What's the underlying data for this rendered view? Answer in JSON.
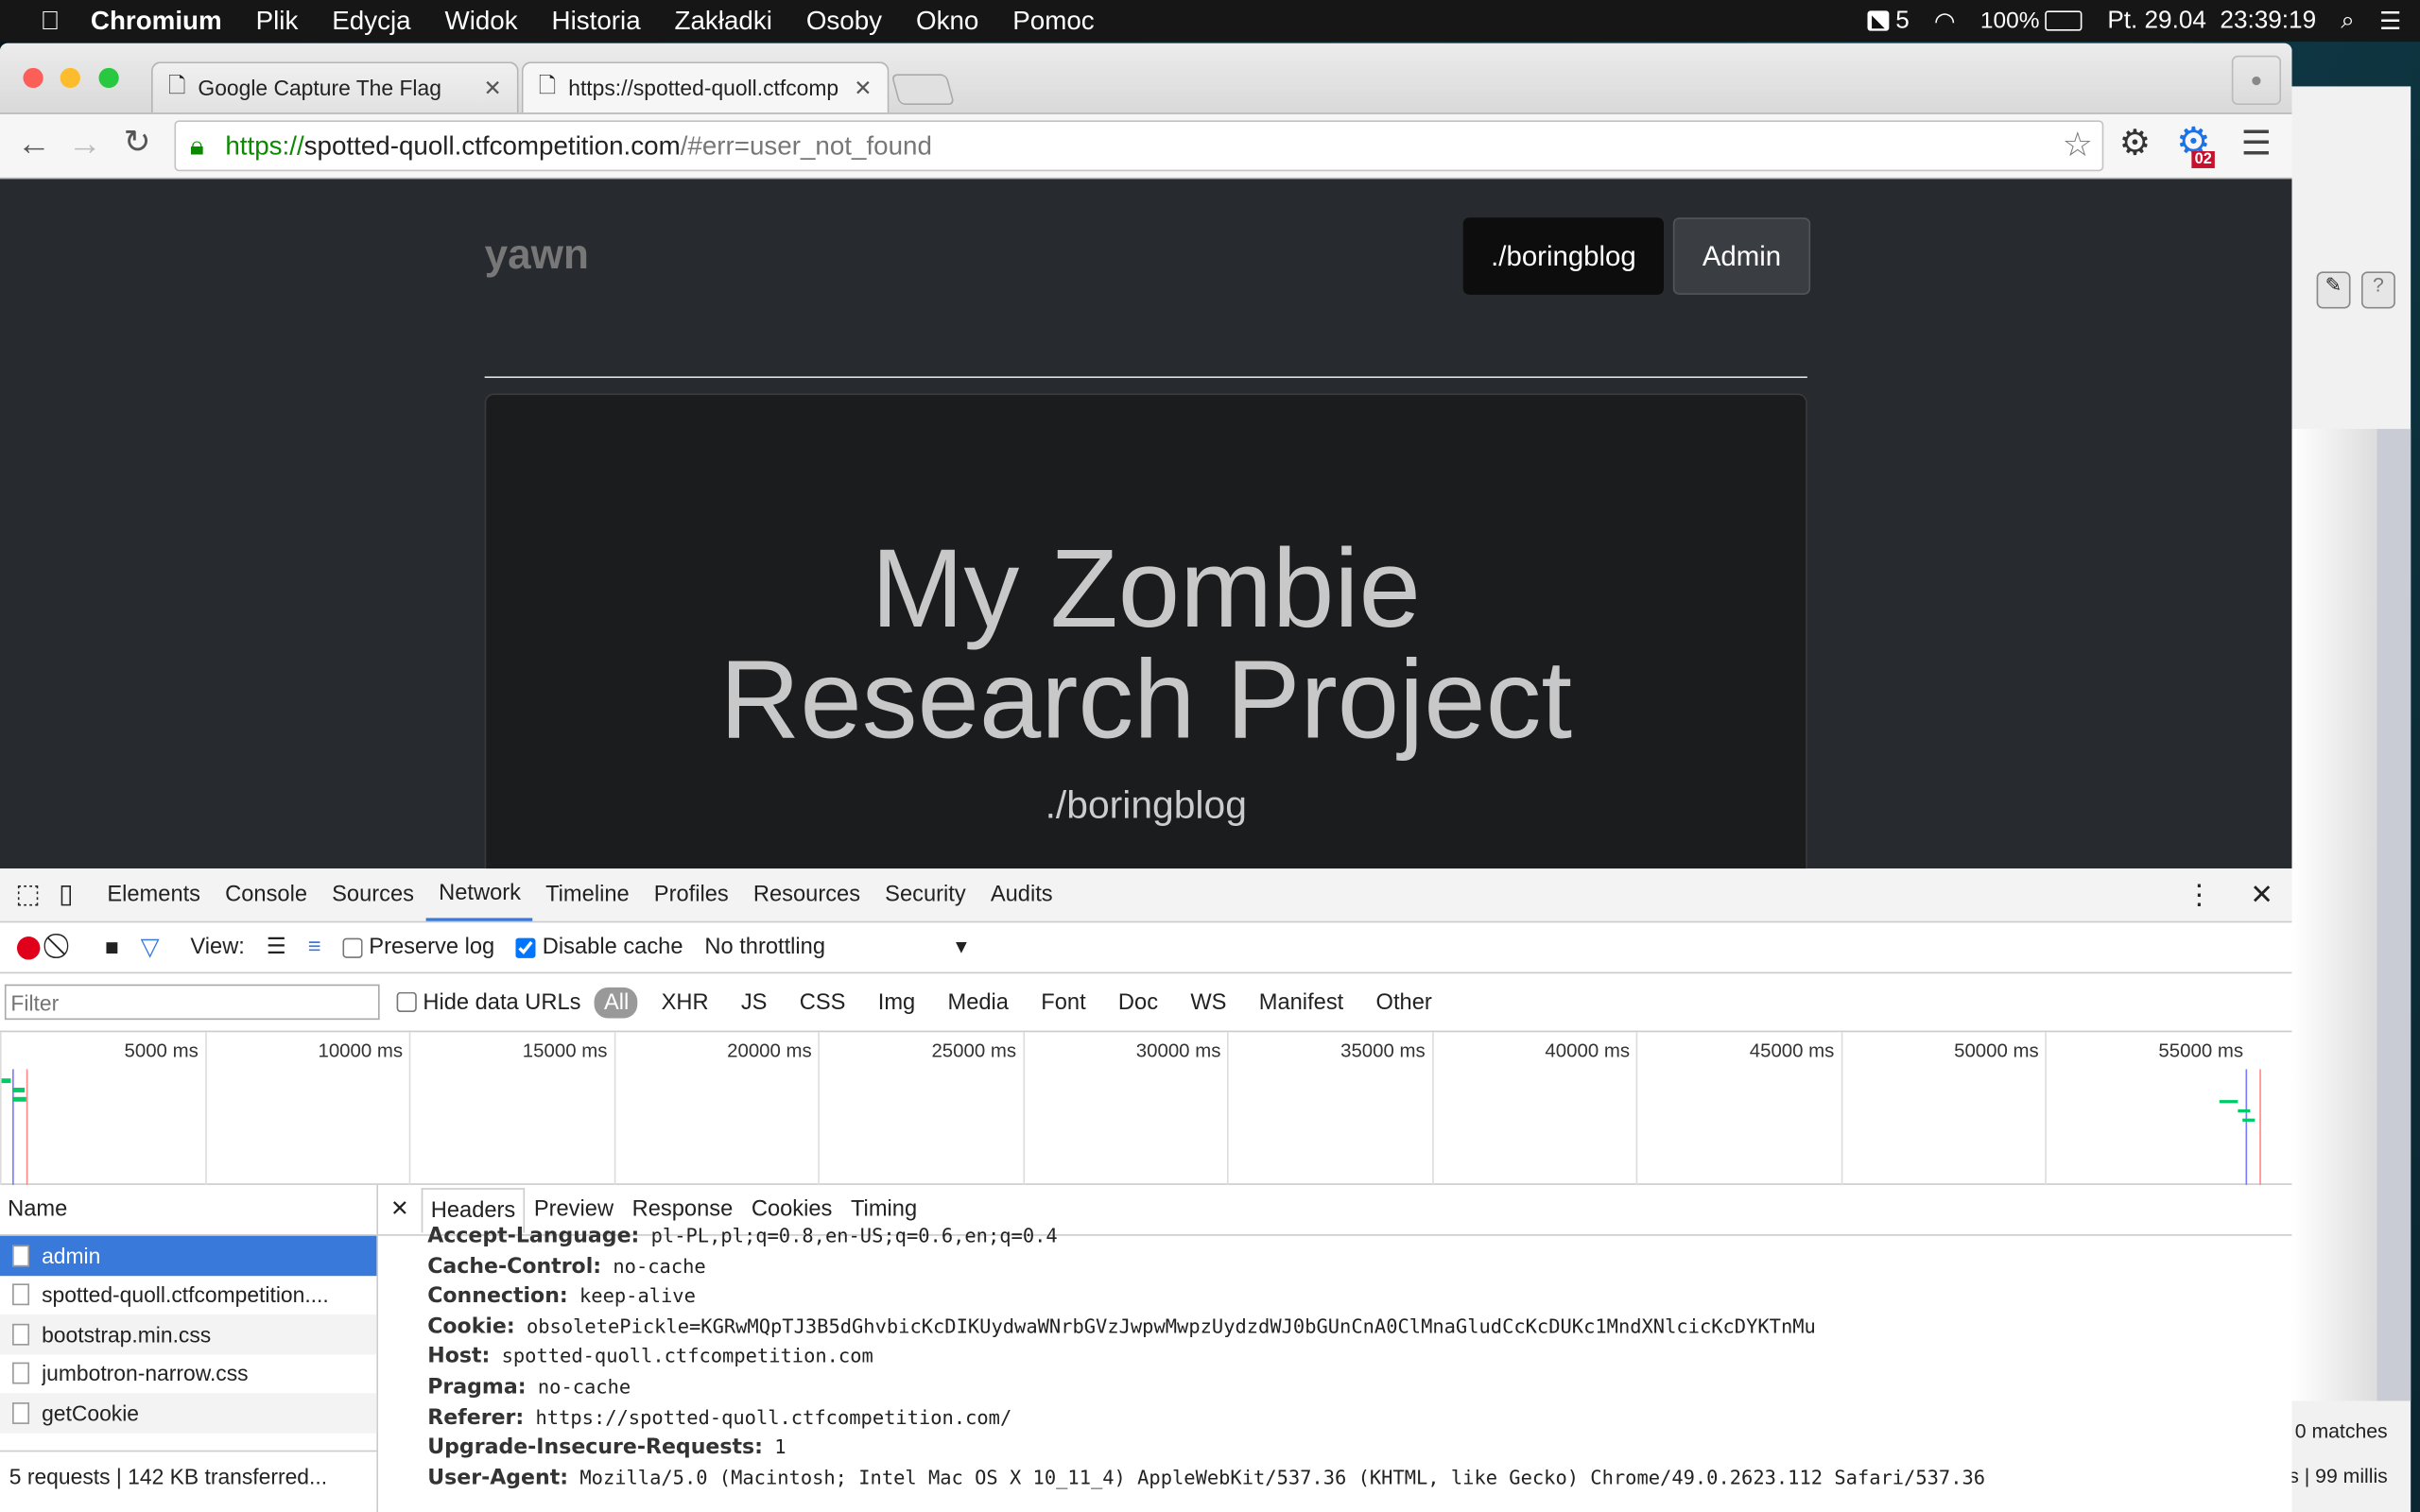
{
  "menubar": {
    "app": "Chromium",
    "items": [
      "Plik",
      "Edycja",
      "Widok",
      "Historia",
      "Zakładki",
      "Osoby",
      "Okno",
      "Pomoc"
    ],
    "rss_count": "5",
    "battery": "100%",
    "clock": "Pt. 29.04  23:39:19"
  },
  "tabs": [
    {
      "title": "Google Capture The Flag"
    },
    {
      "title": "https://spotted-quoll.ctfcompetition.com"
    }
  ],
  "omnibox": {
    "scheme": "https://",
    "host": "spotted-quoll.ctfcompetition.com",
    "path": "/#err=user_not_found"
  },
  "extension_badge": "02",
  "page": {
    "brand": "yawn",
    "nav": [
      "./boringblog",
      "Admin"
    ],
    "title1": "My Zombie",
    "title2": "Research Project",
    "subtitle": "./boringblog"
  },
  "devtools": {
    "tabs": [
      "Elements",
      "Console",
      "Sources",
      "Network",
      "Timeline",
      "Profiles",
      "Resources",
      "Security",
      "Audits"
    ],
    "active_tab": "Network",
    "view_label": "View:",
    "preserve_log": "Preserve log",
    "disable_cache": "Disable cache",
    "throttling": "No throttling",
    "filter_placeholder": "Filter",
    "hide_data_urls": "Hide data URLs",
    "types": [
      "All",
      "XHR",
      "JS",
      "CSS",
      "Img",
      "Media",
      "Font",
      "Doc",
      "WS",
      "Manifest",
      "Other"
    ],
    "ticks": [
      "5000 ms",
      "10000 ms",
      "15000 ms",
      "20000 ms",
      "25000 ms",
      "30000 ms",
      "35000 ms",
      "40000 ms",
      "45000 ms",
      "50000 ms",
      "55000 ms"
    ],
    "name_header": "Name",
    "requests": [
      "admin",
      "spotted-quoll.ctfcompetition....",
      "bootstrap.min.css",
      "jumbotron-narrow.css",
      "getCookie"
    ],
    "summary": "5 requests | 142 KB transferred...",
    "detail_tabs": [
      "Headers",
      "Preview",
      "Response",
      "Cookies",
      "Timing"
    ],
    "headers": [
      {
        "k": "Accept-Language:",
        "v": "pl-PL,pl;q=0.8,en-US;q=0.6,en;q=0.4"
      },
      {
        "k": "Cache-Control:",
        "v": "no-cache"
      },
      {
        "k": "Connection:",
        "v": "keep-alive"
      },
      {
        "k": "Cookie:",
        "v": "obsoletePickle=KGRwMQpTJ3B5dGhvbicKcDIKUydwaWNrbGVzJwpwMwpzUydzdWJ0bGUnCnA0ClMnaGludCcKcDUKc1MndXNlcicKcDYKTnMu"
      },
      {
        "k": "Host:",
        "v": "spotted-quoll.ctfcompetition.com"
      },
      {
        "k": "Pragma:",
        "v": "no-cache"
      },
      {
        "k": "Referer:",
        "v": "https://spotted-quoll.ctfcompetition.com/"
      },
      {
        "k": "Upgrade-Insecure-Requests:",
        "v": "1"
      },
      {
        "k": "User-Agent:",
        "v": "Mozilla/5.0 (Macintosh; Intel Mac OS X 10_11_4) AppleWebKit/537.36 (KHTML, like Gecko) Chrome/49.0.2623.112 Safari/537.36"
      }
    ]
  },
  "side_window": {
    "matches": "0 matches",
    "timing": "s | 99 millis"
  },
  "colors": {
    "accent": "#3879d9",
    "https_green": "#0b8a00",
    "record_red": "#e0001b"
  }
}
